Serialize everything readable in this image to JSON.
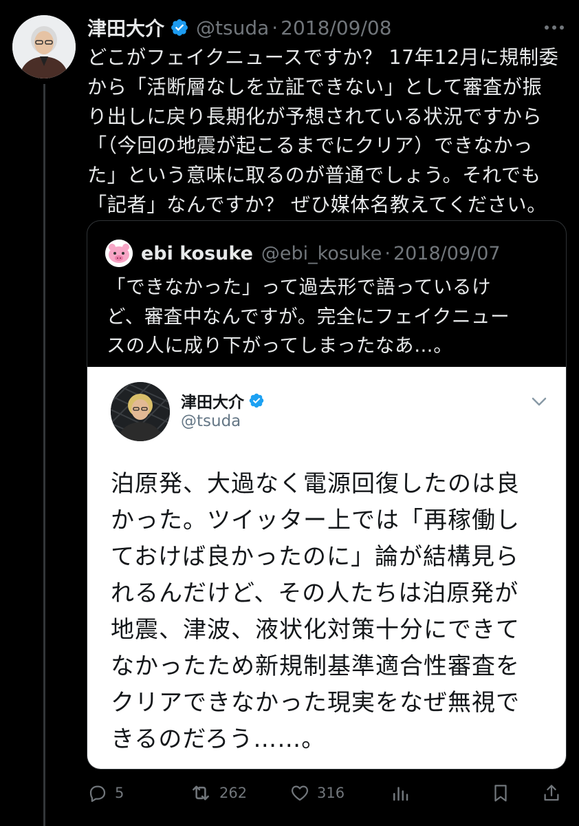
{
  "tweet": {
    "author_name": "津田大介",
    "handle": "@tsuda",
    "separator": "·",
    "date": "2018/09/08",
    "more_icon": "more-horizontal-icon",
    "text_lines": [
      "どこがフェイクニュースですか？ 17年12月に規制委",
      "から「活断層なしを立証できない」として審査が振",
      "り出しに戻り長期化が予想されている状況ですから",
      "「（今回の地震が起こるまでにクリア）できなかっ",
      "た」という意味に取るのが普通でしょう。それでも",
      "「記者」なんですか？ ぜひ媒体名教えてください。"
    ]
  },
  "quote": {
    "author_name": "ebi kosuke",
    "handle": "@ebi_kosuke",
    "separator": "·",
    "date": "2018/09/07",
    "text_lines": [
      "「できなかった」って過去形で語っているけ",
      "ど、審査中なんですが。完全にフェイクニュー",
      "スの人に成り下がってしまったなあ…。"
    ]
  },
  "embedded": {
    "author_name": "津田大介",
    "handle": "@tsuda",
    "text_lines": [
      "泊原発、大過なく電源回復したのは良",
      "かった。ツイッター上では「再稼働し",
      "ておけば良かったのに」論が結構見ら",
      "れるんだけど、その人たちは泊原発が",
      "地震、津波、液状化対策十分にできて",
      "なかったため新規制基準適合性審査を",
      "クリアできなかった現実をなぜ無視で",
      "きるのだろう……。"
    ]
  },
  "actions": {
    "reply_count": "5",
    "retweet_count": "262",
    "like_count": "316"
  },
  "colors": {
    "background": "#000000",
    "text": "#e7e9ea",
    "secondary": "#71767b",
    "verified": "#1d9bf0",
    "border": "#2f3336"
  }
}
